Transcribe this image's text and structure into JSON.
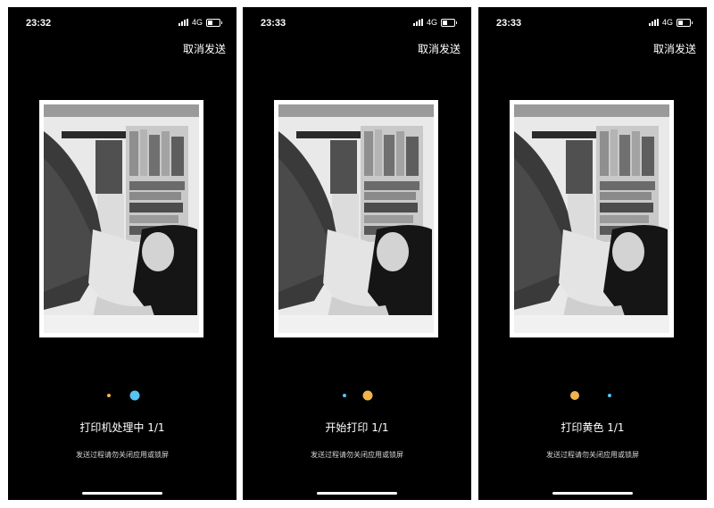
{
  "screens": [
    {
      "time": "23:32",
      "network": "4G",
      "cancel_label": "取消发送",
      "status_label": "打印机处理中 1/1",
      "hint_label": "发送过程请勿关闭应用或锁屏",
      "dots": [
        {
          "color": "#f0b44c",
          "size": "small"
        },
        {
          "color": "#56c3f0",
          "size": "large"
        }
      ]
    },
    {
      "time": "23:33",
      "network": "4G",
      "cancel_label": "取消发送",
      "status_label": "开始打印 1/1",
      "hint_label": "发送过程请勿关闭应用或锁屏",
      "dots": [
        {
          "color": "#56c3f0",
          "size": "small"
        },
        {
          "color": "#f0b44c",
          "size": "large"
        }
      ]
    },
    {
      "time": "23:33",
      "network": "4G",
      "cancel_label": "取消发送",
      "status_label": "打印黄色 1/1",
      "hint_label": "发送过程请勿关闭应用或锁屏",
      "dots": [
        {
          "color": "#f0b44c",
          "size": "large"
        },
        {
          "color": "#56c3f0",
          "size": "small"
        }
      ]
    }
  ]
}
